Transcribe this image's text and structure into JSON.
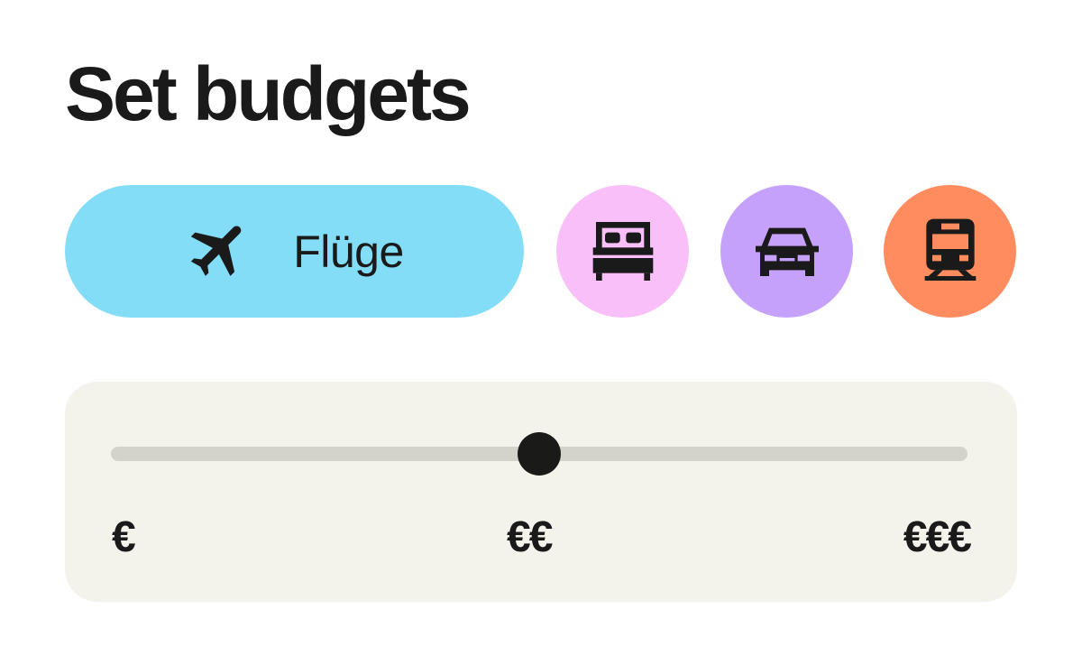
{
  "page": {
    "title": "Set budgets"
  },
  "categories": {
    "active": {
      "label": "Flüge",
      "icon": "airplane-icon",
      "color": "#84DDF7"
    },
    "hotel": {
      "icon": "bed-icon",
      "color": "#F8BFF8"
    },
    "car": {
      "icon": "car-icon",
      "color": "#C5A1FB"
    },
    "train": {
      "icon": "train-icon",
      "color": "#FF8C5E"
    }
  },
  "budget": {
    "panel_color": "#F4F3EB",
    "track_color": "#D4D3CB",
    "thumb_color": "#1A1A18",
    "value_fraction": 0.5,
    "labels": {
      "low": "€",
      "mid": "€€",
      "high": "€€€"
    }
  }
}
